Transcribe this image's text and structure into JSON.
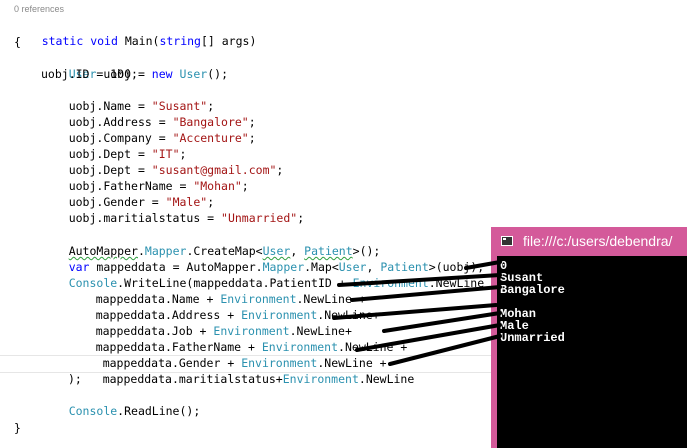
{
  "editor": {
    "references_label": "0 references",
    "lines": {
      "l1": [
        "static",
        " ",
        "void",
        " Main(",
        "string",
        "[] args)"
      ],
      "l2": "{",
      "l3": [
        "User",
        " uobj = ",
        "new",
        " ",
        "User",
        "();"
      ],
      "l4": "uobj.ID = 100;",
      "l5": [
        "uobj.Name = ",
        "\"Susant\"",
        ";"
      ],
      "l6": [
        "uobj.Address = ",
        "\"Bangalore\"",
        ";"
      ],
      "l7": [
        "uobj.Company = ",
        "\"Accenture\"",
        ";"
      ],
      "l8": [
        "uobj.Dept = ",
        "\"IT\"",
        ";"
      ],
      "l9": [
        "uobj.Dept = ",
        "\"susant@gmail.com\"",
        ";"
      ],
      "l10": [
        "uobj.FatherName = ",
        "\"Mohan\"",
        ";"
      ],
      "l11": [
        "uobj.Gender = ",
        "\"Male\"",
        ";"
      ],
      "l12": [
        "uobj.maritialstatus = ",
        "\"Unmarried\"",
        ";"
      ],
      "l13": [
        "AutoMapper",
        ".",
        "Mapper",
        ".CreateMap<",
        "User",
        ", ",
        "Patient",
        ">();"
      ],
      "l14": [
        "var",
        " mappeddata = AutoMapper.",
        "Mapper",
        ".Map<",
        "User",
        ", ",
        "Patient",
        ">(uobj);"
      ],
      "l15": [
        "Console",
        ".WriteLine(mappeddata.PatientID + ",
        "Environment",
        ".NewLine +"
      ],
      "l16": [
        "mappeddata.Name + ",
        "Environment",
        ".NewLine +"
      ],
      "l17": [
        "mappeddata.Address + ",
        "Environment",
        ".NewLine+"
      ],
      "l18": [
        "mappeddata.Job + ",
        "Environment",
        ".NewLine+"
      ],
      "l19": [
        "mappeddata.FatherName + ",
        "Environment",
        ".NewLine +"
      ],
      "l20": [
        "mappeddata.Gender + ",
        "Environment",
        ".NewLine +"
      ],
      "l21": [
        "mappeddata.maritialstatus+",
        "Environment",
        ".NewLine"
      ],
      "l22": ");",
      "l23": [
        "Console",
        ".ReadLine();"
      ],
      "l24": "}"
    }
  },
  "console_window": {
    "title": "file:///c:/users/debendra/",
    "output": [
      "0",
      "Susant",
      "Bangalore",
      "",
      "Mohan",
      "Male",
      "Unmarried"
    ]
  },
  "colors": {
    "keyword": "#0000ff",
    "type": "#2b91af",
    "string": "#a31515",
    "console_frame": "#d45a9a",
    "console_bg": "#000000",
    "arrow": "#000000"
  }
}
